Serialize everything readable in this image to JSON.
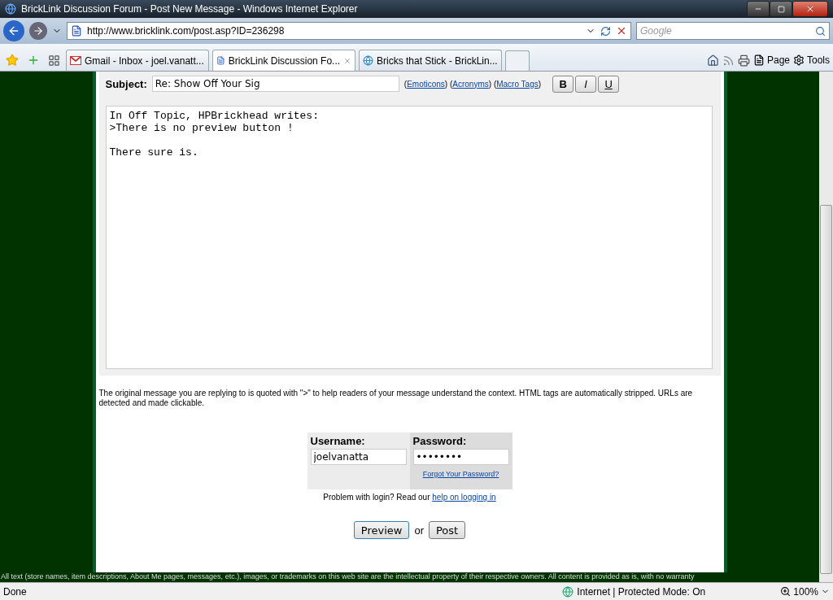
{
  "window": {
    "title": "BrickLink Discussion Forum - Post New Message - Windows Internet Explorer"
  },
  "address_bar": {
    "url": "http://www.bricklink.com/post.asp?ID=236298"
  },
  "search": {
    "placeholder": "Google"
  },
  "tabs": [
    {
      "label": "Gmail - Inbox - joel.vanatt...",
      "selected": false,
      "kind": "gmail"
    },
    {
      "label": "BrickLink Discussion Fo...",
      "selected": true,
      "kind": "brick"
    },
    {
      "label": "Bricks that Stick - BrickLin...",
      "selected": false,
      "kind": "ie"
    }
  ],
  "command_bar": {
    "page": "Page",
    "tools": "Tools"
  },
  "form": {
    "subject_label": "Subject:",
    "subject": "Re: Show Off Your Sig",
    "links": [
      {
        "open": "(",
        "label": "Emoticons",
        "close": ")"
      },
      {
        "open": "(",
        "label": "Acronyms",
        "close": ")"
      },
      {
        "open": "(",
        "label": "Macro Tags",
        "close": ")"
      }
    ],
    "format_buttons": [
      "B",
      "I",
      "U"
    ],
    "message": "In Off Topic, HPBrickhead writes:\n>There is no preview button !\n\nThere sure is.",
    "note": "The original message you are replying to is quoted with \">\" to help readers of your message understand the context. HTML tags are automatically stripped. URLs are detected and made clickable.",
    "username_label": "Username:",
    "username": "joelvanatta",
    "password_label": "Password:",
    "password": "••••••••",
    "forgot_link": "Forgot Your Password?",
    "help_text": "Problem with login? Read our",
    "help_link": "help on logging in",
    "preview_button": "Preview",
    "or": "or",
    "post_button": "Post"
  },
  "footer": "All text (store names, item descriptions, About Me pages, messages, etc.), images, or trademarks on this web site are the intellectual property of their respective owners. All content is provided as is, with no warranty",
  "status_bar": {
    "status": "Done",
    "zone": "Internet | Protected Mode: On",
    "zoom": "100%"
  }
}
